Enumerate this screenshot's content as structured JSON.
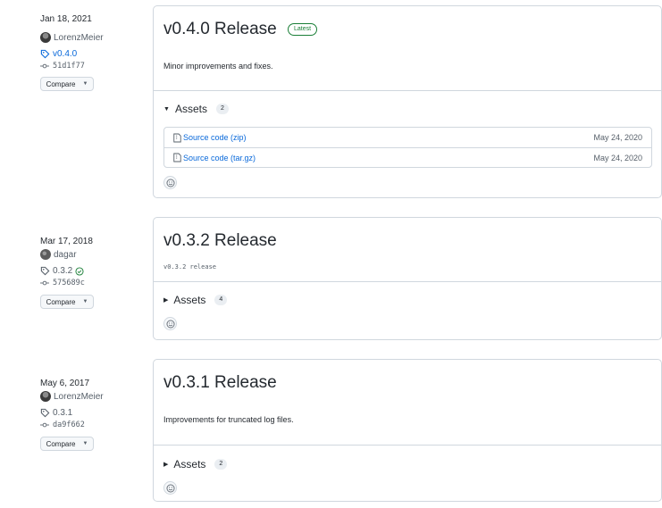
{
  "releases": [
    {
      "date": "Jan 18, 2021",
      "author": "LorenzMeier",
      "tag": "v0.4.0",
      "commit": "51d1f77",
      "compare_label": "Compare",
      "title": "v0.4.0 Release",
      "badge": "Latest",
      "description": "Minor improvements and fixes.",
      "assets_label": "Assets",
      "assets_count": "2",
      "assets": [
        {
          "name": "Source code (zip)",
          "date": "May 24, 2020"
        },
        {
          "name": "Source code (tar.gz)",
          "date": "May 24, 2020"
        }
      ]
    },
    {
      "date": "Mar 17, 2018",
      "author": "dagar",
      "tag": "0.3.2",
      "commit": "575689c",
      "compare_label": "Compare",
      "title": "v0.3.2 Release",
      "description": "v0.3.2 release",
      "assets_label": "Assets",
      "assets_count": "4"
    },
    {
      "date": "May 6, 2017",
      "author": "LorenzMeier",
      "tag": "0.3.1",
      "commit": "da9f662",
      "compare_label": "Compare",
      "title": "v0.3.1 Release",
      "description": "Improvements for truncated log files.",
      "assets_label": "Assets",
      "assets_count": "2"
    }
  ],
  "colors": {
    "link": "#0969da",
    "latest": "#1a7f37",
    "border": "#d0d7de",
    "verified": "#1a7f37"
  },
  "icons": {
    "tag": "tag-icon",
    "commit": "git-commit-icon",
    "file": "file-zip-icon",
    "react": "smiley-icon",
    "verified": "check-circle-icon"
  }
}
